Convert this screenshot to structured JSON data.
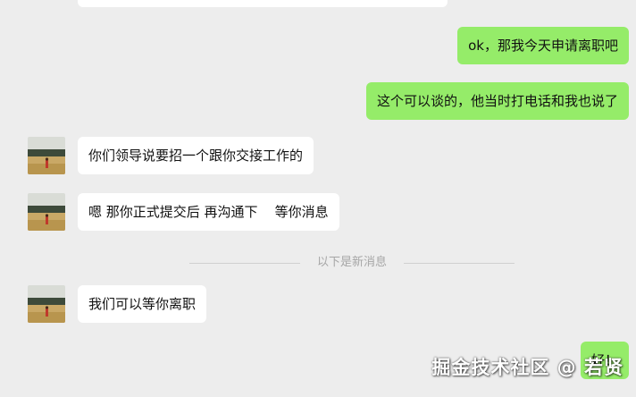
{
  "colors": {
    "background": "#ededed",
    "incoming_bubble": "#ffffff",
    "outgoing_bubble": "#95ec69",
    "divider_text": "#a6a6a6"
  },
  "messages": [
    {
      "direction": "incoming",
      "text": ""
    },
    {
      "direction": "outgoing",
      "text": "ok，那我今天申请离职吧"
    },
    {
      "direction": "outgoing",
      "text": "这个可以谈的，他当时打电话和我也说了"
    },
    {
      "direction": "incoming",
      "text": "你们领导说要招一个跟你交接工作的",
      "avatar": "field-photo"
    },
    {
      "direction": "incoming",
      "text": "嗯 那你正式提交后 再沟通下    等你消息",
      "avatar": "field-photo"
    },
    {
      "direction": "incoming",
      "text": "我们可以等你离职",
      "avatar": "field-photo"
    },
    {
      "direction": "outgoing",
      "text": "好！"
    }
  ],
  "divider": {
    "text": "以下是新消息"
  },
  "watermark": "掘金技术社区 @ 若贤"
}
